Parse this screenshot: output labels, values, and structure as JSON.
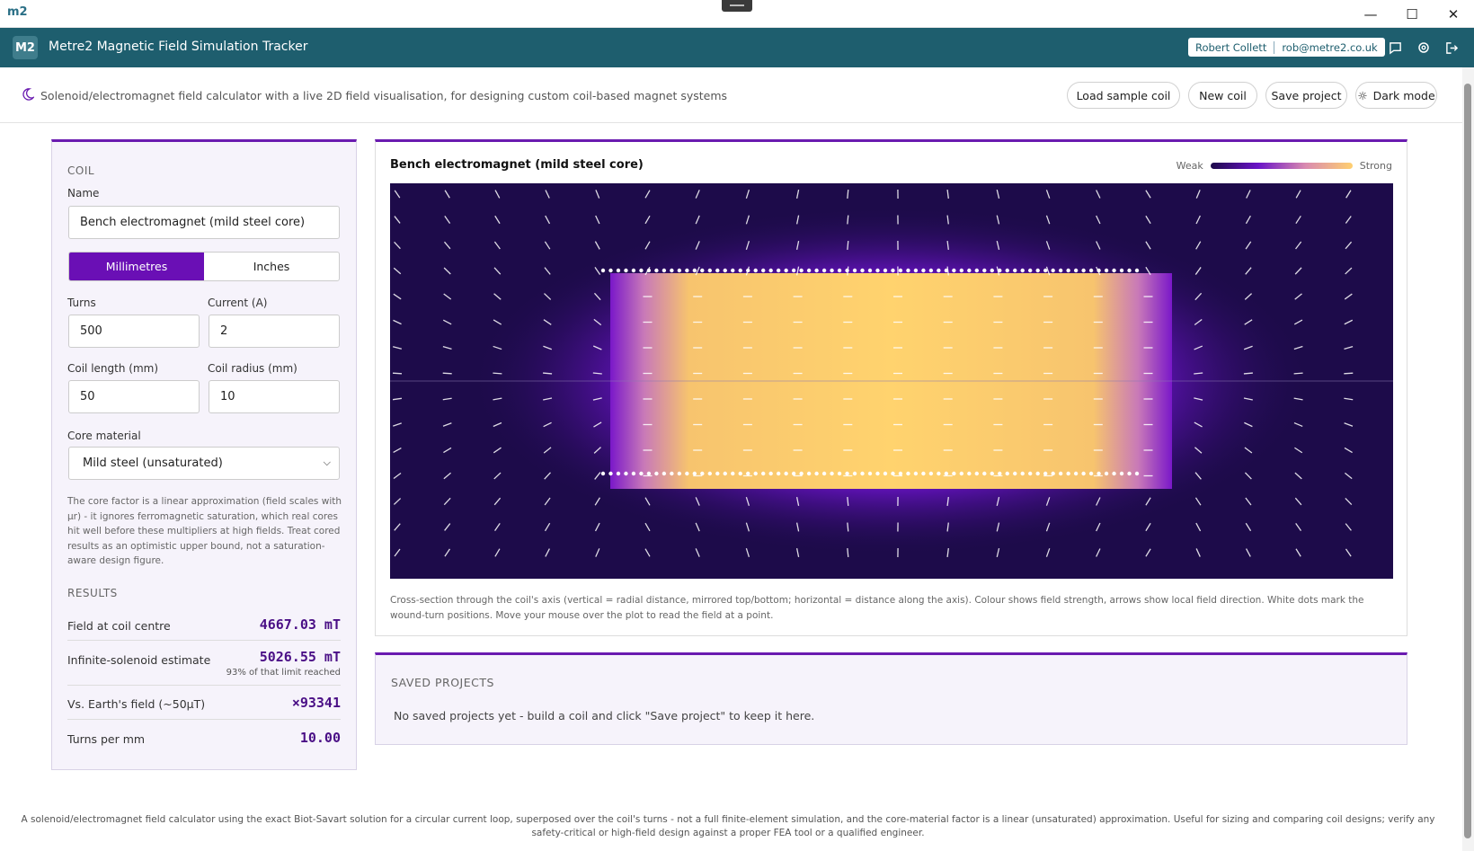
{
  "titlebar": {
    "logo": "m2"
  },
  "header": {
    "badge": "M2",
    "title": "Metre2 Magnetic Field Simulation Tracker",
    "user_name": "Robert Collett",
    "user_email": "rob@metre2.co.uk"
  },
  "subbar": {
    "description": "Solenoid/electromagnet field calculator with a live 2D field visualisation, for designing custom coil-based magnet systems",
    "buttons": {
      "load_sample": "Load sample coil",
      "new_coil": "New coil",
      "save_project": "Save project",
      "dark_mode": "Dark mode"
    }
  },
  "coil": {
    "section": "COIL",
    "name_label": "Name",
    "name_value": "Bench electromagnet (mild steel core)",
    "units": {
      "mm": "Millimetres",
      "in": "Inches"
    },
    "turns_label": "Turns",
    "turns_value": "500",
    "current_label": "Current (A)",
    "current_value": "2",
    "length_label": "Coil length (mm)",
    "length_value": "50",
    "radius_label": "Coil radius (mm)",
    "radius_value": "10",
    "core_label": "Core material",
    "core_value": "Mild steel (unsaturated)",
    "note": "The core factor is a linear approximation (field scales with μr) - it ignores ferromagnetic saturation, which real cores hit well before these multipliers at high fields. Treat cored results as an optimistic upper bound, not a saturation-aware design figure."
  },
  "results": {
    "section": "RESULTS",
    "centre_label": "Field at coil centre",
    "centre_value": "4667.03 mT",
    "infinite_label": "Infinite-solenoid estimate",
    "infinite_value": "5026.55 mT",
    "infinite_sub": "93% of that limit reached",
    "earth_label": "Vs. Earth's field (~50μT)",
    "earth_value": "×93341",
    "tpm_label": "Turns per mm",
    "tpm_value": "10.00"
  },
  "viz": {
    "title": "Bench electromagnet (mild steel core)",
    "legend_weak": "Weak",
    "legend_strong": "Strong",
    "caption": "Cross-section through the coil's axis (vertical = radial distance, mirrored top/bottom; horizontal = distance along the axis). Colour shows field strength, arrows show local field direction. White dots mark the wound-turn positions. Move your mouse over the plot to read the field at a point.",
    "colors": {
      "background": "#1d0b4a",
      "glow": "#6a13c7",
      "core": "#ffd070"
    }
  },
  "saved": {
    "heading": "SAVED PROJECTS",
    "empty": "No saved projects yet - build a coil and click \"Save project\" to keep it here."
  },
  "footer": "A solenoid/electromagnet field calculator using the exact Biot-Savart solution for a circular current loop, superposed over the coil's turns - not a full finite-element simulation, and the core-material factor is a linear (unsaturated) approximation. Useful for sizing and comparing coil designs; verify any safety-critical or high-field design against a proper FEA tool or a qualified engineer."
}
